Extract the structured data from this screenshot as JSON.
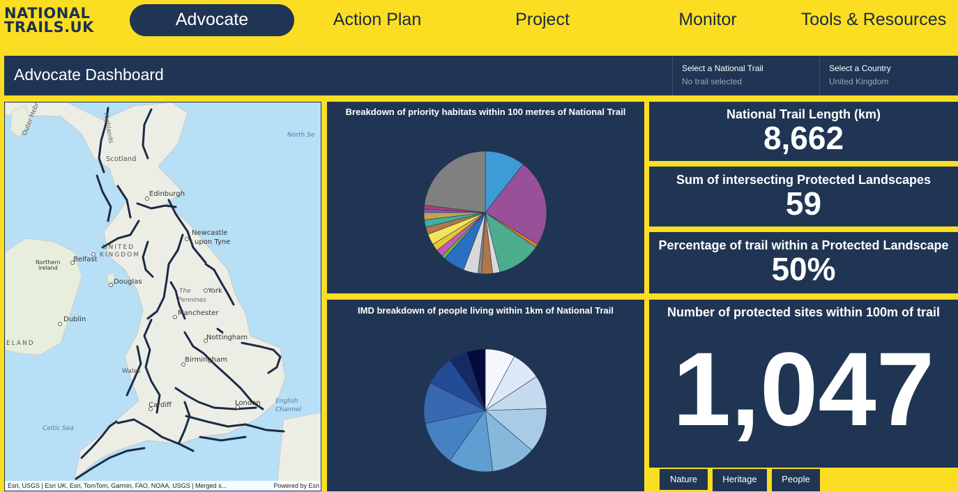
{
  "logo": {
    "line1": "NATIONAL",
    "line2": "TRAILS.UK"
  },
  "nav": {
    "tabs": [
      "Advocate",
      "Action Plan",
      "Project",
      "Monitor",
      "Tools & Resources"
    ],
    "active": "Advocate"
  },
  "header": {
    "title": "Advocate Dashboard",
    "trail_selector": {
      "label": "Select a National Trail",
      "value": "No trail selected"
    },
    "country_selector": {
      "label": "Select a Country",
      "value": "United Kingdom"
    }
  },
  "map": {
    "labels": {
      "outer_hebrides": "Outer Hebrides",
      "highlands": "Highlands",
      "north_sea": "North Se",
      "scotland": "Scotland",
      "edinburgh": "Edinburgh",
      "newcastle": "Newcastle",
      "upon_tyne": "upon Tyne",
      "united": "UNITED",
      "kingdom": "KINGDOM",
      "northern": "Northern",
      "ireland": "Ireland",
      "belfast": "Belfast",
      "douglas": "Douglas",
      "the": "The",
      "pennines": "Pennines",
      "york": "York",
      "manchester": "Manchester",
      "dublin": "Dublin",
      "eland": "ELAND",
      "nottingham": "Nottingham",
      "birmingham": "Birmingham",
      "wales": "Wales",
      "cardiff": "Cardiff",
      "london": "London",
      "english": "English",
      "channel": "Channel",
      "celtic_sea": "Celtic Sea"
    },
    "attribution": "Esri, USGS | Esri UK, Esri, TomTom, Garmin, FAO, NOAA, USGS | Merged s...",
    "powered_by": "Powered by Esri"
  },
  "habitats_panel": {
    "title": "Breakdown of priority habitats within 100 metres of National Trail"
  },
  "imd_panel": {
    "title": "IMD breakdown of people living within 1km of National Trail"
  },
  "stats": {
    "trail_length": {
      "title": "National Trail Length (km)",
      "value": "8,662"
    },
    "protected_landscapes": {
      "title": "Sum of intersecting Protected Landscapes",
      "value": "59"
    },
    "percentage": {
      "title": "Percentage of trail within a Protected Landscape",
      "value": "50%"
    },
    "protected_sites": {
      "title": "Number of protected sites within 100m of trail",
      "value": "1,047"
    }
  },
  "bottom_tabs": [
    "Nature",
    "Heritage",
    "People"
  ],
  "chart_data": [
    {
      "type": "pie",
      "title": "Breakdown of priority habitats within 100 metres of National Trail",
      "values": [
        11,
        24,
        1,
        12,
        2,
        3,
        1,
        4,
        6,
        1,
        2,
        2,
        3,
        2,
        2,
        2,
        1,
        1,
        24
      ],
      "colors": [
        "#3d9bd6",
        "#985198",
        "#e07b24",
        "#4cad8f",
        "#d8d8d8",
        "#b07845",
        "#888888",
        "#d8d8d8",
        "#2b6fc2",
        "#5fbf3f",
        "#c45ab8",
        "#e8c830",
        "#f5e25a",
        "#b07845",
        "#40b0a0",
        "#c8a050",
        "#6a5fc8",
        "#c03a6a",
        "#808080"
      ]
    },
    {
      "type": "pie",
      "title": "IMD breakdown of people living within 1km of National Trail",
      "values": [
        8,
        8,
        9,
        12,
        12,
        12,
        12,
        11,
        8,
        5,
        5
      ],
      "colors": [
        "#f4f8fd",
        "#dde9f6",
        "#c5d9ef",
        "#a9cbe6",
        "#86b8dc",
        "#5f9ed1",
        "#4682c2",
        "#3869b0",
        "#234c96",
        "#142a66",
        "#060a3b"
      ]
    }
  ]
}
